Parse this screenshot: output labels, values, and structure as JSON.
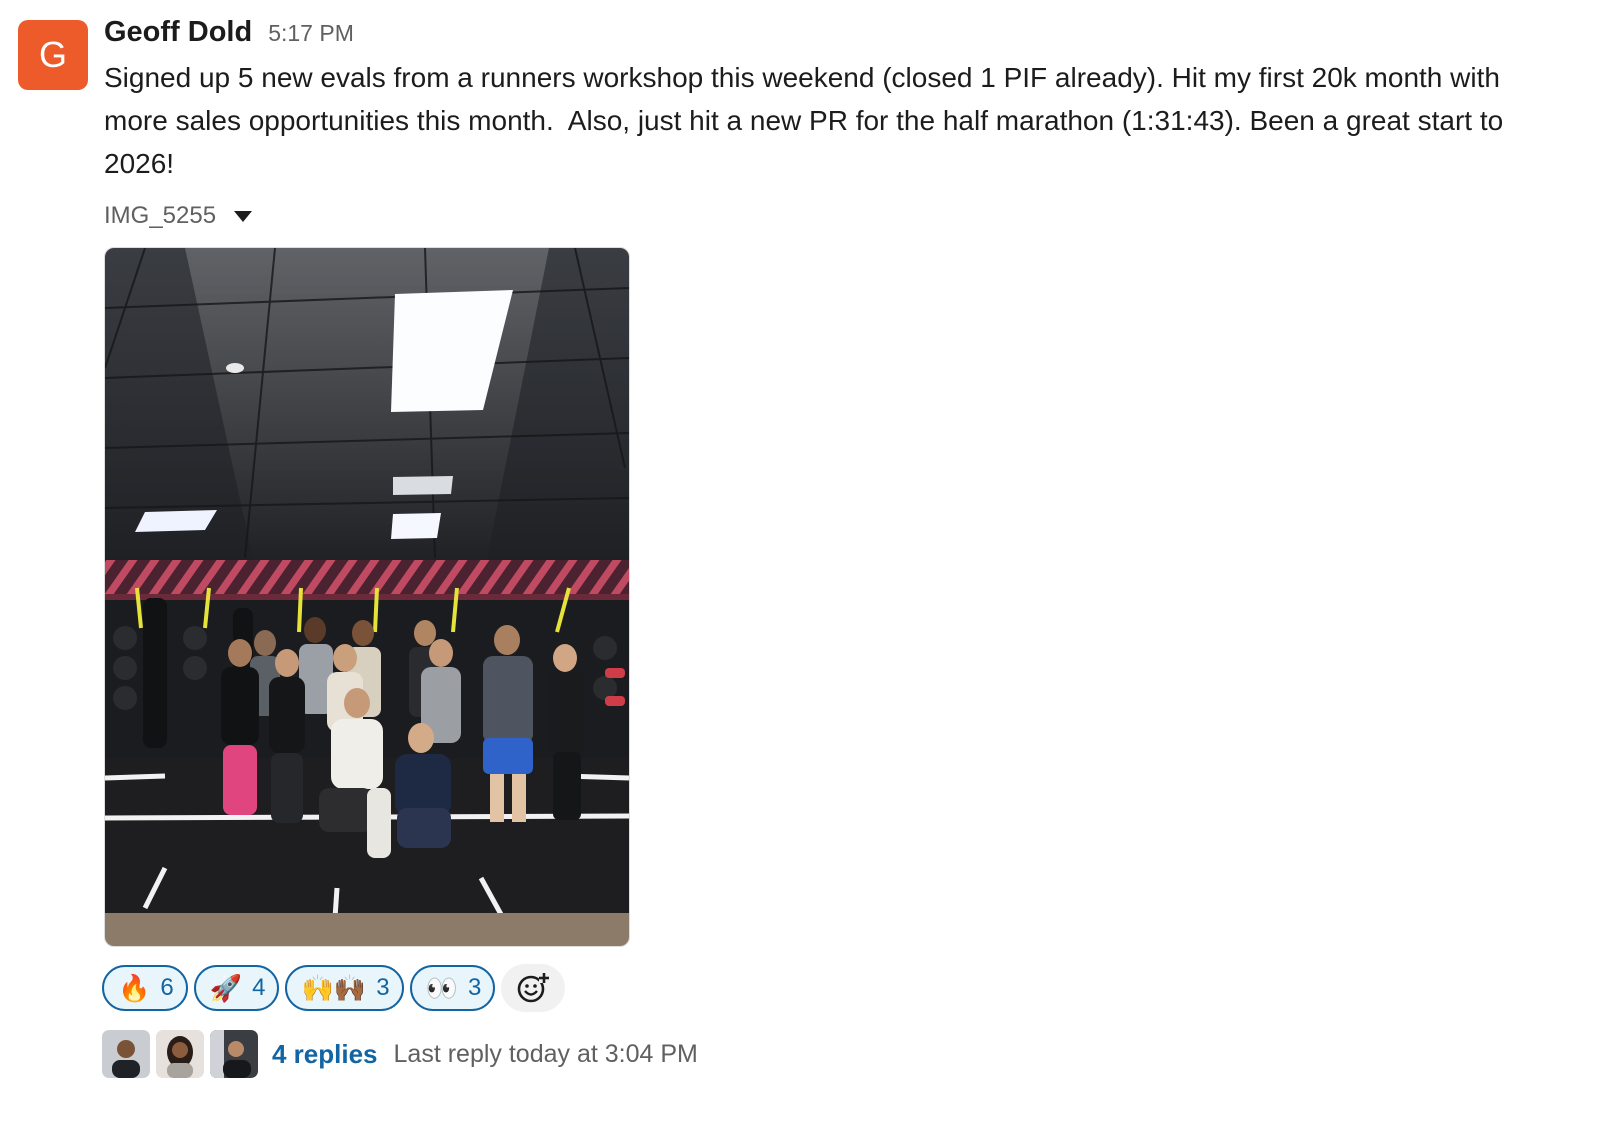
{
  "message": {
    "avatar_letter": "G",
    "avatar_color": "#ee5b2b",
    "sender": "Geoff Dold",
    "timestamp": "5:17 PM",
    "text": "Signed up 5 new evals from a runners workshop this weekend (closed 1 PIF already). Hit my first 20k month with more sales opportunities this month.  Also, just hit a new PR for the half marathon (1:31:43). Been a great start to 2026!",
    "attachment": {
      "filename": "IMG_5255",
      "toggle_icon": "caret-down-icon"
    }
  },
  "reactions": [
    {
      "emoji": "🔥",
      "name": "fire-icon",
      "count": "6"
    },
    {
      "emoji": "🚀",
      "name": "rocket-icon",
      "count": "4"
    },
    {
      "emoji": "🙌🙌🏾",
      "name": "raised-hands-icon",
      "count": "3"
    },
    {
      "emoji": "👀",
      "name": "eyes-icon",
      "count": "3"
    }
  ],
  "add_reaction_icon": "add-reaction-icon",
  "thread": {
    "replies": "4 replies",
    "last_reply": "Last reply today at 3:04 PM"
  },
  "colors": {
    "link": "#1264a3",
    "reaction_bg": "#e8f5fa",
    "muted_text": "#616061"
  }
}
